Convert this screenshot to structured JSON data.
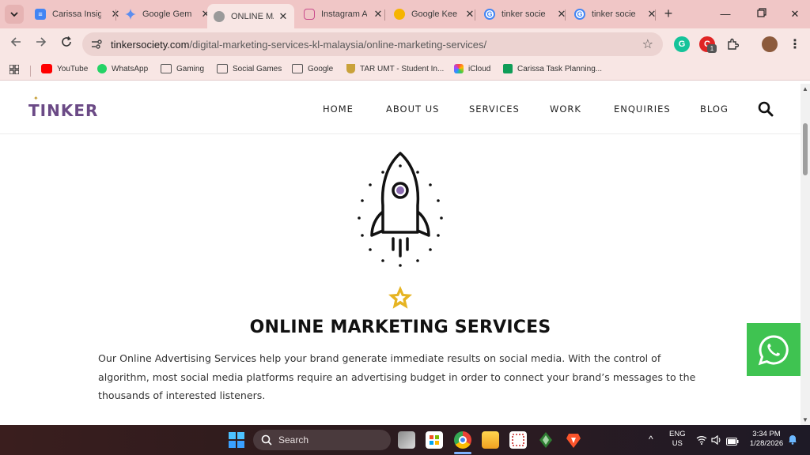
{
  "browser": {
    "tabs": [
      {
        "title": "Carissa Insig",
        "icon": "google-docs-icon",
        "color": "#4285f4"
      },
      {
        "title": "Google Gem",
        "icon": "gemini-icon",
        "color": "#8e7cf0"
      },
      {
        "title": "ONLINE MA",
        "icon": "globe-icon",
        "color": "#9a9a9a",
        "active": true
      },
      {
        "title": "Instagram A",
        "icon": "instagram-icon",
        "color": "#c94b8c"
      },
      {
        "title": "Google Kee",
        "icon": "google-keep-icon",
        "color": "#f6b400"
      },
      {
        "title": "tinker socie",
        "icon": "google-icon",
        "color": "#4285f4"
      },
      {
        "title": "tinker socie",
        "icon": "google-icon",
        "color": "#4285f4"
      }
    ],
    "url_domain": "tinkersociety.com",
    "url_path": "/digital-marketing-services-kl-malaysia/online-marketing-services/",
    "extension_badge": "1",
    "bookmarks": [
      {
        "label": "YouTube",
        "icon": "youtube-icon"
      },
      {
        "label": "WhatsApp",
        "icon": "whatsapp-icon"
      },
      {
        "label": "Gaming",
        "icon": "folder-icon"
      },
      {
        "label": "Social Games",
        "icon": "folder-icon"
      },
      {
        "label": "Google",
        "icon": "folder-icon"
      },
      {
        "label": "TAR UMT - Student In...",
        "icon": "tarumt-icon"
      },
      {
        "label": "iCloud",
        "icon": "icloud-icon"
      },
      {
        "label": "Carissa Task Planning...",
        "icon": "sheets-icon"
      }
    ]
  },
  "site": {
    "logo": "TINKER",
    "nav": [
      "HOME",
      "ABOUT US",
      "SERVICES",
      "WORK",
      "ENQUIRIES",
      "BLOG"
    ],
    "heading": "ONLINE MARKETING SERVICES",
    "body": "Our Online Advertising Services help your brand generate immediate results on social media. With the control of algorithm, most social media platforms require an advertising budget in order to connect your brand’s messages to the thousands of interested listeners.",
    "accent": "#6b4a86",
    "star_color": "#e6b422",
    "whatsapp_color": "#3fc351"
  },
  "taskbar": {
    "search_label": "Search",
    "lang_1": "ENG",
    "lang_2": "US",
    "time": "3:34 PM",
    "date": "1/28/2026"
  }
}
